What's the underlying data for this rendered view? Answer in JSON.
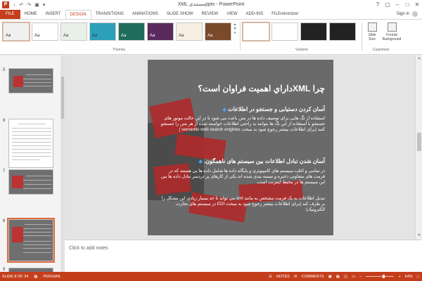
{
  "window": {
    "title": "XML مستندی‌pptx - PowerPoint",
    "qat": [
      "↓",
      "↶",
      "↷",
      "▣",
      "▾"
    ],
    "controls": {
      "help": "?",
      "ribbon_options": "▢",
      "minimize": "–",
      "maximize": "□",
      "close": "✕"
    },
    "file_icon_letter": "P"
  },
  "ribbon": {
    "tabs": [
      "FILE",
      "HOME",
      "INSERT",
      "DESIGN",
      "TRANSITIONS",
      "ANIMATIONS",
      "SLIDE SHOW",
      "REVIEW",
      "VIEW",
      "ADD-INS",
      "FILEminimizer"
    ],
    "active_tab": "DESIGN",
    "sign_in": "Sign in",
    "themes_label": "Themes",
    "variants_label": "Variants",
    "customize_label": "Customize",
    "theme_sample_text": "Aa",
    "gallery_scroll": [
      "▲",
      "▼",
      "▾"
    ],
    "slide_size_label": "Slide Size",
    "format_background_label": "Format Background",
    "theme_colors": [
      "#f0f0f0",
      "#ffffff",
      "#e8f0e8",
      "#ffffff",
      "#2ca0b8",
      "#1f6c5c",
      "#5a2a5e",
      "#ffffff",
      "#7a4a2a",
      "#ffffff"
    ],
    "variant_colors": [
      "#ffffff",
      "#ffffff",
      "#222222",
      "#222222"
    ]
  },
  "thumbnails": [
    {
      "num": "5",
      "kind": "dark"
    },
    {
      "num": "6",
      "kind": "doc"
    },
    {
      "num": "7",
      "kind": "dark"
    },
    {
      "num": "8",
      "kind": "dark",
      "selected": true
    },
    {
      "num": "9",
      "kind": "dark"
    }
  ],
  "slide": {
    "title": "چرا XMLداراي اهميت فراوان است؟",
    "bullet_mark": "◆",
    "bullets": [
      {
        "heading": "آسان کردن دستیابی و جستجو در اطلاعات",
        "text": "استفاده از تگ هایی برای توصیف داده ها در متن باعث می شود تا در این حالت موتور های جستجو با استفاده از این تگ ها بتوانند به راحتی اطلاعات خواسته شده از هر متن را جستجو کنند (برای اطلاعات بیشتر رجوع شود به مبحث semantic web search engines )"
      },
      {
        "heading": "آسان شدن تبادل اطلاعات بین سیستم های ناهمگون.",
        "text": "در تمامی و اغلب سیستم های کامپیوتری و پایگاه داده ها شامل داده ها یی هستند که در فرمت های متفاوتی ذخیره و نسبته بندی شده اند یکی از کارهای پر دردسر تبادل داده ها بین این سیستم ها در محیط اینترنت است."
      },
      {
        "heading": "",
        "text": "تبدیل اطلاعات به یک فرمت مشخص به مانند xml می تواند تا حد بسیار زیادی این مشکل را بر طرف کند (برای اطلاعات بیشتر رجوع شود به مبحث EDI در سیستم های تجارت الکترونیک)"
      }
    ]
  },
  "notes": {
    "placeholder": "Click to add notes"
  },
  "status": {
    "slide_indicator": "SLIDE 8 OF 34",
    "language": "PERSIAN",
    "notes_label": "NOTES",
    "comments_label": "COMMENTS",
    "zoom": "64%",
    "zoom_fraction": 0.64
  }
}
